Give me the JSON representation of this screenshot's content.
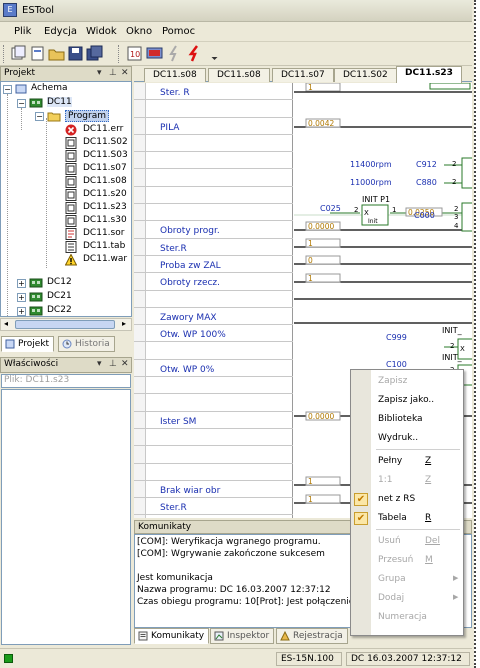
{
  "window": {
    "title": "ESTool",
    "app_icon": "app-icon"
  },
  "menu": [
    "Plik",
    "Edycja",
    "Widok",
    "Okno",
    "Pomoc"
  ],
  "toolbar": {
    "icons": [
      "new-project-icon",
      "new-file-icon",
      "open-folder-icon",
      "save-icon",
      "save-all-icon",
      "compile-icon",
      "monitor-icon",
      "disconnect-icon",
      "connect-icon"
    ]
  },
  "project_panel": {
    "title": "Projekt",
    "tree": {
      "root": "Achema",
      "dc11": "DC11",
      "program": "Program",
      "files": [
        "DC11.err",
        "DC11.S02",
        "DC11.S03",
        "DC11.s07",
        "DC11.s08",
        "DC11.s20",
        "DC11.s23",
        "DC11.s30",
        "DC11.sor",
        "DC11.tab",
        "DC11.war"
      ],
      "siblings": [
        "DC12",
        "DC21",
        "DC22"
      ]
    },
    "tabs": [
      "Projekt",
      "Historia"
    ]
  },
  "properties_panel": {
    "title": "Właściwości",
    "field": "Plik: DC11.s23"
  },
  "doc_tabs": [
    "DC11.s08",
    "DC11.s08",
    "DC11.s07",
    "DC11.S02",
    "DC11.s23"
  ],
  "signals": [
    "Ster. R",
    "",
    "PILA",
    "",
    "",
    "",
    "",
    "",
    "Obroty progr.",
    "Ster.R",
    "Proba zw ZAL",
    "Obroty rzecz.",
    "",
    "Zawory MAX",
    "Otw. WP 100%",
    "",
    "Otw. WP 0%",
    "",
    "",
    "Ister SM",
    "",
    "",
    "",
    "Brak wiar obr",
    "Ster.R"
  ],
  "diagram": {
    "values": [
      "1",
      "0.0042",
      "0.0000",
      "1",
      "0",
      "1",
      "0.0000",
      "1",
      "1",
      "0.0250"
    ],
    "labels": [
      "11400rpm",
      "11000rpm",
      "C912",
      "C880",
      "C025",
      "C000",
      "INIT P1",
      "C999",
      "C100",
      "INIT_",
      "INIT_",
      "2",
      "2",
      "2",
      "1",
      "2",
      "3",
      "4",
      "2",
      "2",
      "X",
      "X",
      "Init"
    ]
  },
  "messages": {
    "title": "Komunikaty",
    "lines": [
      "[COM]: Weryfikacja wgranego programu.",
      "[COM]: Wgrywanie zakończone sukcesem",
      "",
      "Jest komunikacja",
      "  Nazwa programu: DC 16.03.2007 12:37:12",
      "  Czas obiegu programu: 10[Prot]: Jest połączenie"
    ],
    "tabs": [
      "Komunikaty",
      "Inspektor",
      "Rejestracja"
    ]
  },
  "status": {
    "left_color": "#1a9b1a",
    "device": "ES-15N.100",
    "program": "DC 16.03.2007 12:37:12"
  },
  "context_menu": {
    "items": [
      {
        "label": "Zapisz",
        "shortcut": "",
        "disabled": true,
        "checked": false,
        "submenu": false
      },
      {
        "label": "Zapisz jako..",
        "shortcut": "",
        "disabled": false,
        "checked": false,
        "submenu": false
      },
      {
        "label": "Biblioteka",
        "shortcut": "",
        "disabled": false,
        "checked": false,
        "submenu": false
      },
      {
        "label": "Wydruk..",
        "shortcut": "",
        "disabled": false,
        "checked": false,
        "submenu": false
      },
      {
        "label": "Pełny",
        "shortcut": "Z",
        "disabled": false,
        "checked": false,
        "submenu": false
      },
      {
        "label": "1:1",
        "shortcut": "Z",
        "disabled": true,
        "checked": false,
        "submenu": false
      },
      {
        "label": "net z RS",
        "shortcut": "",
        "disabled": false,
        "checked": true,
        "submenu": false
      },
      {
        "label": "Tabela",
        "shortcut": "R",
        "disabled": false,
        "checked": true,
        "submenu": false
      },
      {
        "label": "Usuń",
        "shortcut": "Del",
        "disabled": true,
        "checked": false,
        "submenu": false
      },
      {
        "label": "Przesuń",
        "shortcut": "M",
        "disabled": true,
        "checked": false,
        "submenu": false
      },
      {
        "label": "Grupa",
        "shortcut": "",
        "disabled": true,
        "checked": false,
        "submenu": true
      },
      {
        "label": "Dodaj",
        "shortcut": "",
        "disabled": true,
        "checked": false,
        "submenu": true
      },
      {
        "label": "Numeracja",
        "shortcut": "",
        "disabled": true,
        "checked": false,
        "submenu": false
      }
    ]
  },
  "colors": {
    "signal_text": "#1a2fb0",
    "value_text": "#b07800",
    "wire": "#2a7a2a",
    "selection": "#c1d2ee"
  }
}
